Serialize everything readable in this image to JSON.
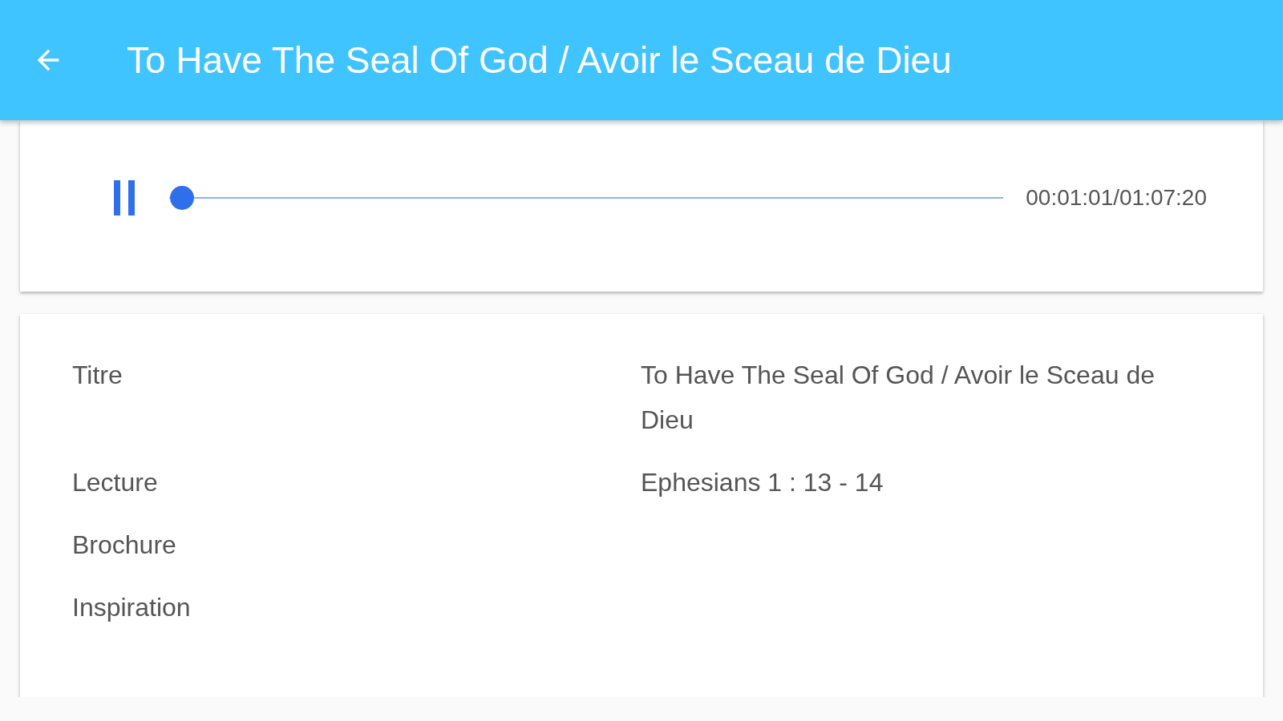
{
  "app_bar": {
    "title": "To Have The Seal Of God / Avoir le Sceau de Dieu"
  },
  "player": {
    "playing": true,
    "level": 0.015,
    "time": "00:01:01/01:07:20"
  },
  "details": [
    {
      "label": "Titre",
      "value": "To Have The Seal Of God / Avoir le Sceau de Dieu"
    },
    {
      "label": "Lecture",
      "value": "Ephesians 1 : 13 - 14"
    },
    {
      "label": "Brochure"
    },
    {
      "label": "Inspiration"
    }
  ]
}
